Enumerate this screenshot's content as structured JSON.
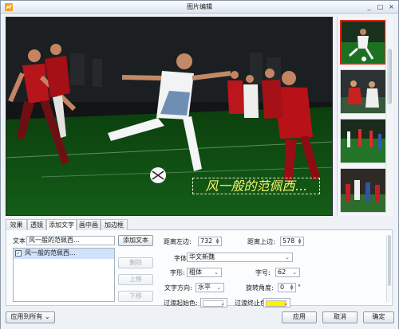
{
  "window": {
    "title": "图片编辑",
    "controls": {
      "minimize": "_",
      "maximize": "□",
      "close": "×"
    }
  },
  "preview": {
    "caption": "风一般的范佩西..."
  },
  "thumbnails": {
    "selected_index": 0,
    "count": 4
  },
  "tabs": [
    {
      "label": "效果"
    },
    {
      "label": "透镜"
    },
    {
      "label": "添加文字",
      "active": true
    },
    {
      "label": "画中画"
    },
    {
      "label": "加边框"
    }
  ],
  "text_panel": {
    "text_label": "文本:",
    "text_value": "风一般的范佩西...",
    "add_text_button": "添加文本",
    "list_items": [
      {
        "text": "风一般的范佩西...",
        "checked": true
      }
    ],
    "delete_button": "删除",
    "move_up_button": "上移",
    "move_down_button": "下移",
    "left_label": "距离左边:",
    "left_value": "732",
    "top_label": "距离上边:",
    "top_value": "578",
    "font_label": "字体:",
    "font_value": "华文新魏",
    "style_label": "字形:",
    "style_value": "粗体",
    "size_label": "字号:",
    "size_value": "62",
    "direction_label": "文字方向:",
    "direction_value": "水平",
    "rotation_label": "旋转角度:",
    "rotation_value": "0",
    "rotation_unit": "°",
    "gradient_start_label": "过渡起始色:",
    "gradient_start_color": "#ffffff",
    "gradient_end_label": "过渡终止色:",
    "gradient_end_color": "#fff200"
  },
  "footer": {
    "apply_all_button": "应用到所有",
    "apply_button": "应用",
    "cancel_button": "取消",
    "ok_button": "确定"
  },
  "colors": {
    "accent": "#df2418",
    "caption": "#fbf56b"
  }
}
